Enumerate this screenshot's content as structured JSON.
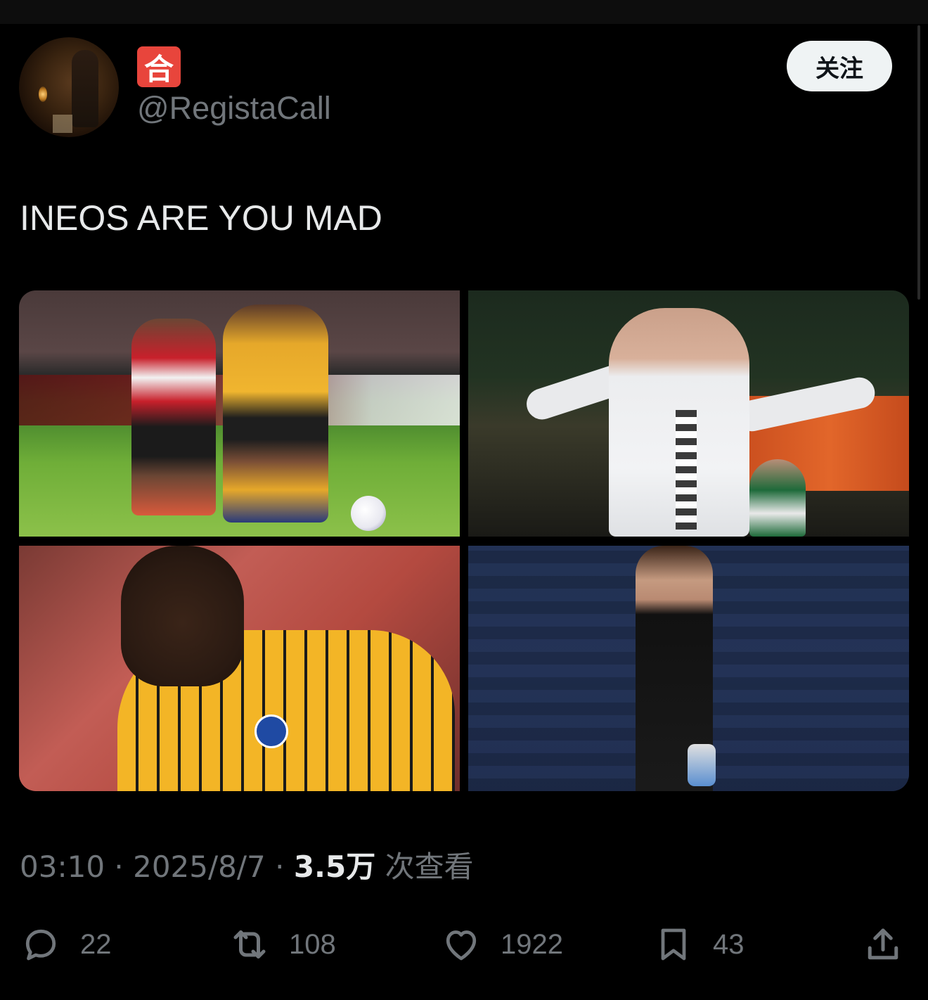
{
  "tweet": {
    "badge_char": "🈴",
    "badge_text": "合",
    "handle": "@RegistaCall",
    "follow_label": "关注",
    "text": "INEOS ARE YOU MAD",
    "time": "03:10",
    "date": "2025/8/7",
    "views_count": "3.5万",
    "views_label": "次查看",
    "media": [
      {
        "name": "photo-brentford-vs-wolves"
      },
      {
        "name": "photo-player-celebrating-white-kit"
      },
      {
        "name": "photo-player-yellow-brighton-kit"
      },
      {
        "name": "photo-goalkeeper-black-kit"
      }
    ]
  },
  "actions": {
    "reply": {
      "icon": "reply-icon",
      "count": "22"
    },
    "retweet": {
      "icon": "retweet-icon",
      "count": "108"
    },
    "like": {
      "icon": "heart-icon",
      "count": "1922"
    },
    "bookmark": {
      "icon": "bookmark-icon",
      "count": "43"
    },
    "share": {
      "icon": "share-icon"
    }
  },
  "colors": {
    "background": "#000000",
    "text": "#e7e9ea",
    "muted": "#71767b",
    "follow_bg": "#eff3f4",
    "badge": "#e8453c"
  }
}
